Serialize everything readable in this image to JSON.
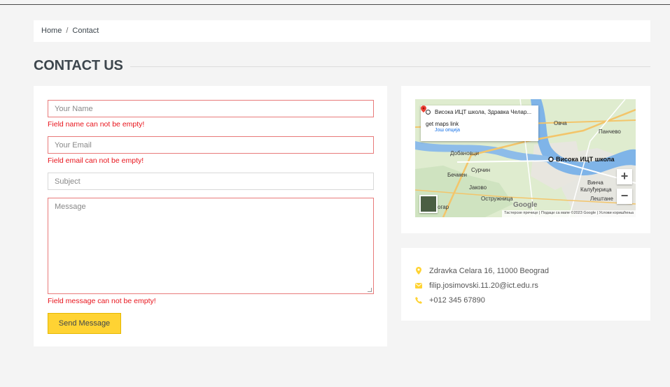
{
  "breadcrumb": {
    "home": "Home",
    "separator": "/",
    "current": "Contact"
  },
  "page_title": "CONTACT US",
  "form": {
    "name_placeholder": "Your Name",
    "name_error": "Field name can not be empty!",
    "email_placeholder": "Your Email",
    "email_error": "Field email can not be empty!",
    "subject_placeholder": "Subject",
    "message_placeholder": "Message",
    "message_error": "Field message can not be empty!",
    "send_label": "Send Message",
    "error_color": "#e8141c",
    "button_color": "#ffd333"
  },
  "map": {
    "popup_title": "Висока ИЦТ школа, Здравка Челар...",
    "popup_link": "get maps link",
    "popup_more": "Још опција",
    "labels": {
      "ovca": "Овча",
      "pancevo": "Панчево",
      "dobanovci": "Добановци",
      "school": "Висока ИЦТ школа",
      "surcin": "Сурчин",
      "becmen": "Бечмен",
      "jakovo": "Јаково",
      "vinca": "Винча",
      "kaludjerica": "Калуђерица",
      "ostruznica": "Остружница",
      "lestane": "Лештане",
      "umka": "огар"
    },
    "google": "Google",
    "footer": "Тастерске пречице | Подаци са мапе ©2023 Google | Услови коришћења",
    "zoom_in": "+",
    "zoom_out": "−"
  },
  "contact": {
    "address": "Zdravka Celara 16, 11000 Beograd",
    "email": "filip.josimovski.11.20@ict.edu.rs",
    "phone": "+012 345 67890",
    "icon_color": "#ffd333"
  }
}
